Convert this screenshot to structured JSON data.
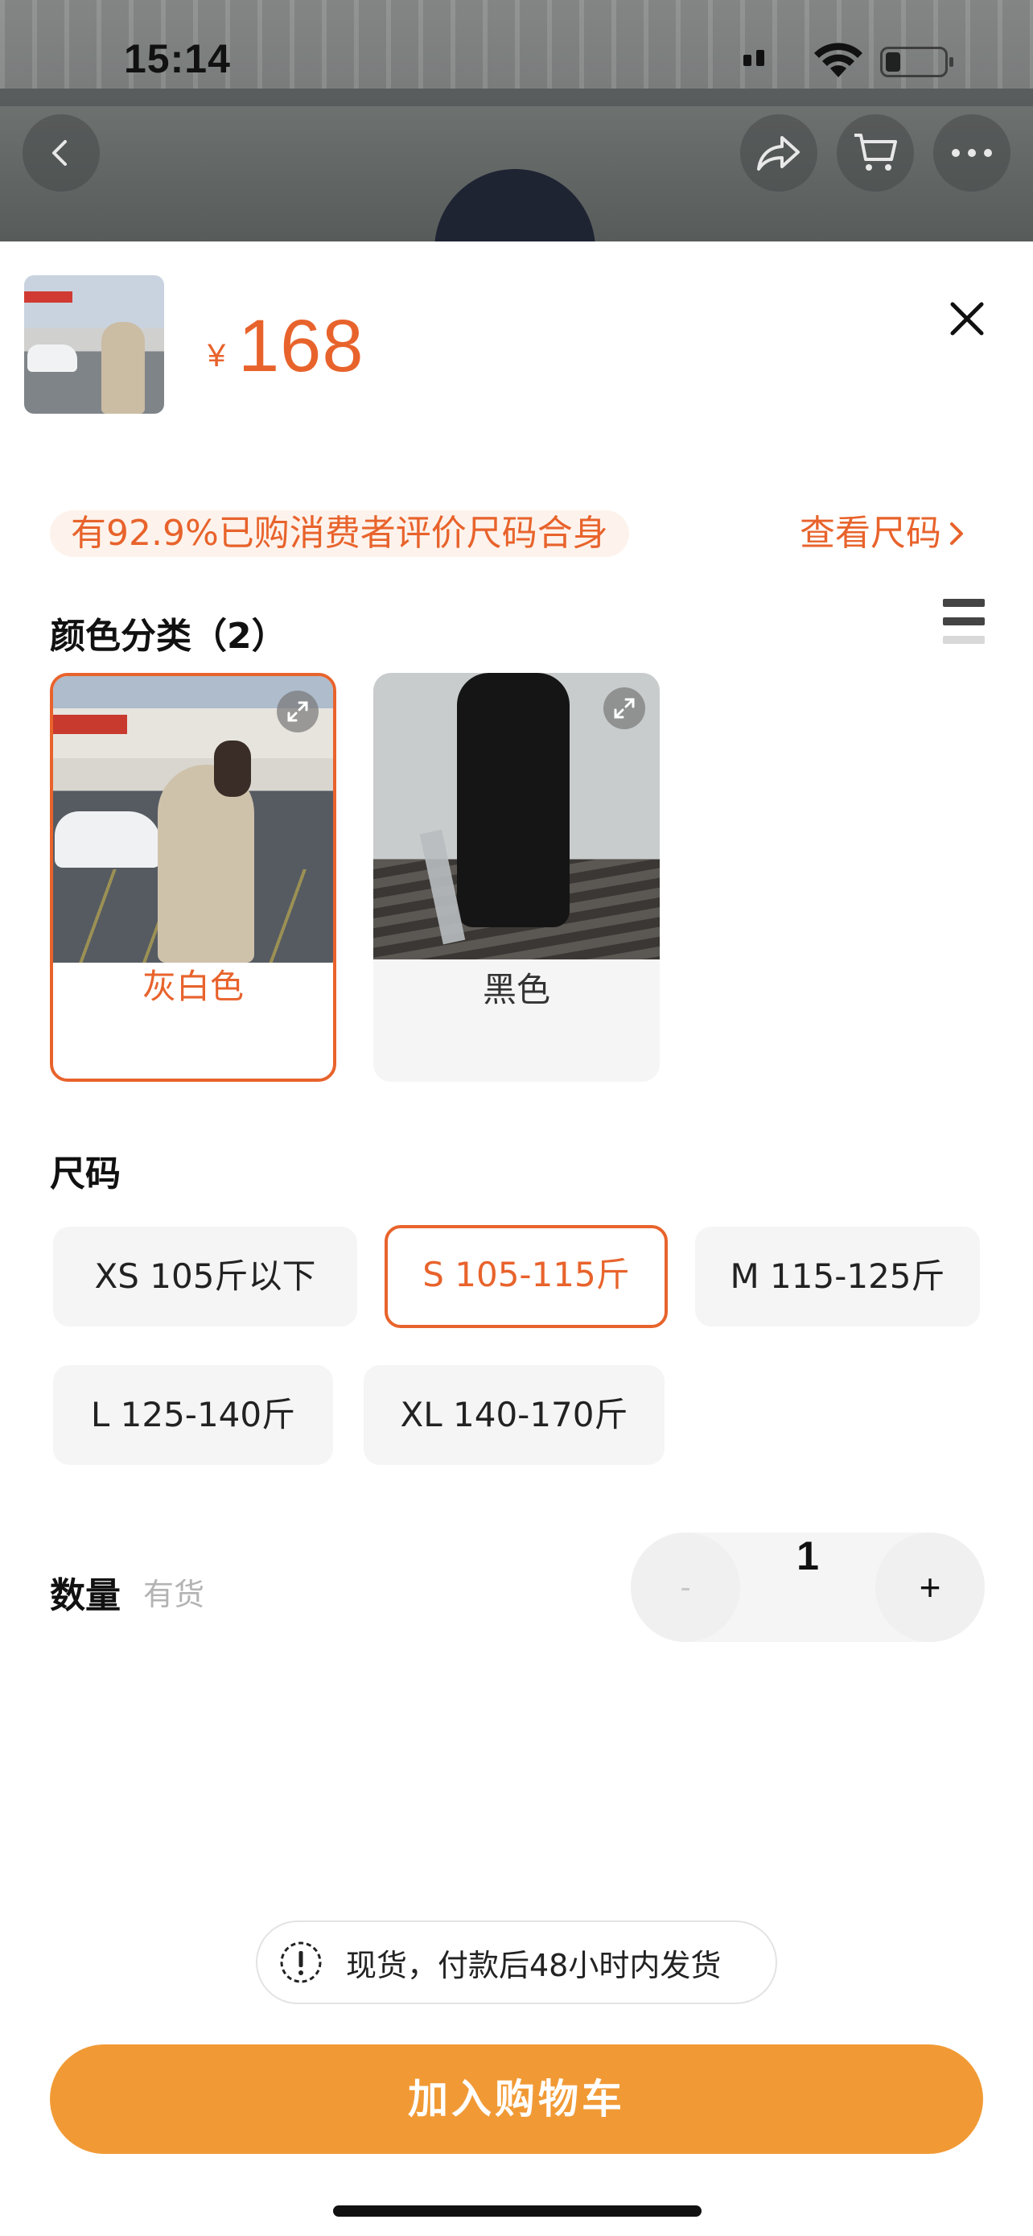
{
  "status_bar": {
    "time": "15:14"
  },
  "top_bar": {
    "back_icon": "chevron-left-icon",
    "share_icon": "share-icon",
    "cart_icon": "cart-icon",
    "more_icon": "more-dots-icon"
  },
  "product": {
    "currency": "¥",
    "price": "168"
  },
  "fit_banner": {
    "text": "有92.9%已购消费者评价尺码合身",
    "size_guide_label": "查看尺码"
  },
  "color_section": {
    "title": "颜色分类（2）",
    "options": [
      {
        "label": "灰白色",
        "selected": true
      },
      {
        "label": "黑色",
        "selected": false
      }
    ]
  },
  "size_section": {
    "title": "尺码",
    "options": [
      {
        "label": "XS 105斤以下",
        "selected": false
      },
      {
        "label": "S 105-115斤",
        "selected": true
      },
      {
        "label": "M 115-125斤",
        "selected": false
      },
      {
        "label": "L 125-140斤",
        "selected": false
      },
      {
        "label": "XL 140-170斤",
        "selected": false
      }
    ]
  },
  "quantity_section": {
    "title": "数量",
    "stock": "有货",
    "minus": "-",
    "value": "1",
    "plus": "+"
  },
  "shipping_note": {
    "text": "现货，付款后48小时内发货"
  },
  "add_to_cart": {
    "label": "加入购物车"
  },
  "colors": {
    "accent": "#e8632c",
    "button": "#f19a35"
  }
}
